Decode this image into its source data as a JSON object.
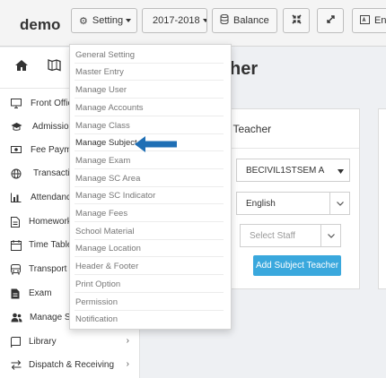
{
  "topbar": {
    "brand": "demo",
    "setting_label": "Setting",
    "session_label": "2017-2018",
    "balance_label": "Balance",
    "language_label": "Eng"
  },
  "sidebar": {
    "items": [
      {
        "label": "Front Office",
        "icon": "monitor-icon"
      },
      {
        "label": "Admission",
        "icon": "graduation-cap-icon"
      },
      {
        "label": "Fee Payme",
        "icon": "money-icon"
      },
      {
        "label": "Transaction",
        "icon": "globe-icon"
      },
      {
        "label": "Attendance",
        "icon": "bar-chart-icon"
      },
      {
        "label": "Homework",
        "icon": "file-icon"
      },
      {
        "label": "Time Table",
        "icon": "calendar-icon"
      },
      {
        "label": "Transport",
        "icon": "bus-icon"
      },
      {
        "label": "Exam",
        "icon": "file-text-icon"
      },
      {
        "label": "Manage Sta",
        "icon": "users-icon"
      },
      {
        "label": "Library",
        "icon": "book-icon",
        "chevron": "›"
      },
      {
        "label": "Dispatch & Receiving",
        "icon": "exchange-icon",
        "chevron": "›"
      }
    ]
  },
  "main": {
    "title": "her",
    "panel_title": "t Teacher",
    "class_select": "BECIVIL1STSEM A",
    "subject_select": "English",
    "staff_placeholder": "Select Staff",
    "add_button": "Add Subject Teacher"
  },
  "menu": {
    "items": [
      "General Setting",
      "Master Entry",
      "Manage User",
      "Manage Accounts",
      "Manage Class",
      "Manage Subject",
      "Manage Exam",
      "Manage SC Area",
      "Manage SC Indicator",
      "Manage Fees",
      "School Material",
      "Manage Location",
      "Header & Footer",
      "Print Option",
      "Permission",
      "Notification"
    ],
    "active_index": 5
  },
  "colors": {
    "accent": "#3aa8dd",
    "arrow": "#1f6fb5"
  }
}
